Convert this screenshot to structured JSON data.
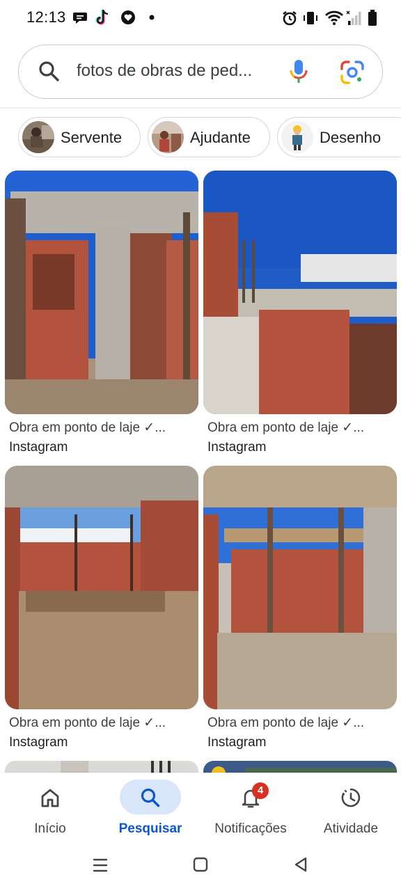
{
  "status_bar": {
    "time": "12:13"
  },
  "search": {
    "query": "fotos de obras de ped..."
  },
  "chips": [
    {
      "label": "Servente"
    },
    {
      "label": "Ajudante"
    },
    {
      "label": "Desenho"
    }
  ],
  "results": [
    {
      "title": "Obra em ponto de laje ✓...",
      "source": "Instagram"
    },
    {
      "title": "Obra em ponto de laje ✓...",
      "source": "Instagram"
    },
    {
      "title": "Obra em ponto de laje ✓...",
      "source": "Instagram"
    },
    {
      "title": "Obra em ponto de laje ✓...",
      "source": "Instagram"
    }
  ],
  "bottom_nav": {
    "items": [
      {
        "label": "Início",
        "icon": "home-icon"
      },
      {
        "label": "Pesquisar",
        "icon": "search-icon",
        "active": true
      },
      {
        "label": "Notificações",
        "icon": "bell-icon",
        "badge": "4"
      },
      {
        "label": "Atividade",
        "icon": "activity-icon"
      }
    ]
  },
  "colors": {
    "accent": "#0b57d0",
    "active_pill": "#d9e5fb",
    "badge": "#d93025"
  }
}
